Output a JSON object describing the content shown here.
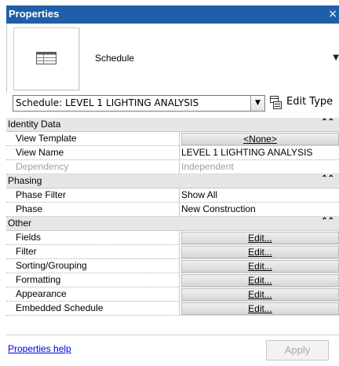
{
  "window": {
    "title": "Properties",
    "close_glyph": "×"
  },
  "type_selector": {
    "name": "Schedule",
    "icon": "schedule-table-icon",
    "dropdown_glyph": "▼"
  },
  "instance": {
    "selected": "Schedule: LEVEL 1 LIGHTING ANALYSIS",
    "edit_type_label": "Edit Type"
  },
  "groups": {
    "identity": {
      "label": "Identity Data",
      "collapse_glyph": "⌃⌃"
    },
    "phasing": {
      "label": "Phasing",
      "collapse_glyph": "⌃⌃"
    },
    "other": {
      "label": "Other",
      "collapse_glyph": "⌃⌃"
    }
  },
  "props": {
    "view_template": {
      "name": "View Template",
      "value": "<None>"
    },
    "view_name": {
      "name": "View Name",
      "value": "LEVEL 1 LIGHTING ANALYSIS"
    },
    "dependency": {
      "name": "Dependency",
      "value": "Independent"
    },
    "phase_filter": {
      "name": "Phase Filter",
      "value": "Show All"
    },
    "phase": {
      "name": "Phase",
      "value": "New Construction"
    },
    "fields": {
      "name": "Fields",
      "value": "Edit..."
    },
    "filter": {
      "name": "Filter",
      "value": "Edit..."
    },
    "sorting": {
      "name": "Sorting/Grouping",
      "value": "Edit..."
    },
    "formatting": {
      "name": "Formatting",
      "value": "Edit..."
    },
    "appearance": {
      "name": "Appearance",
      "value": "Edit..."
    },
    "embedded": {
      "name": "Embedded Schedule",
      "value": "Edit..."
    }
  },
  "footer": {
    "help_link": "Properties help",
    "apply_label": "Apply"
  }
}
